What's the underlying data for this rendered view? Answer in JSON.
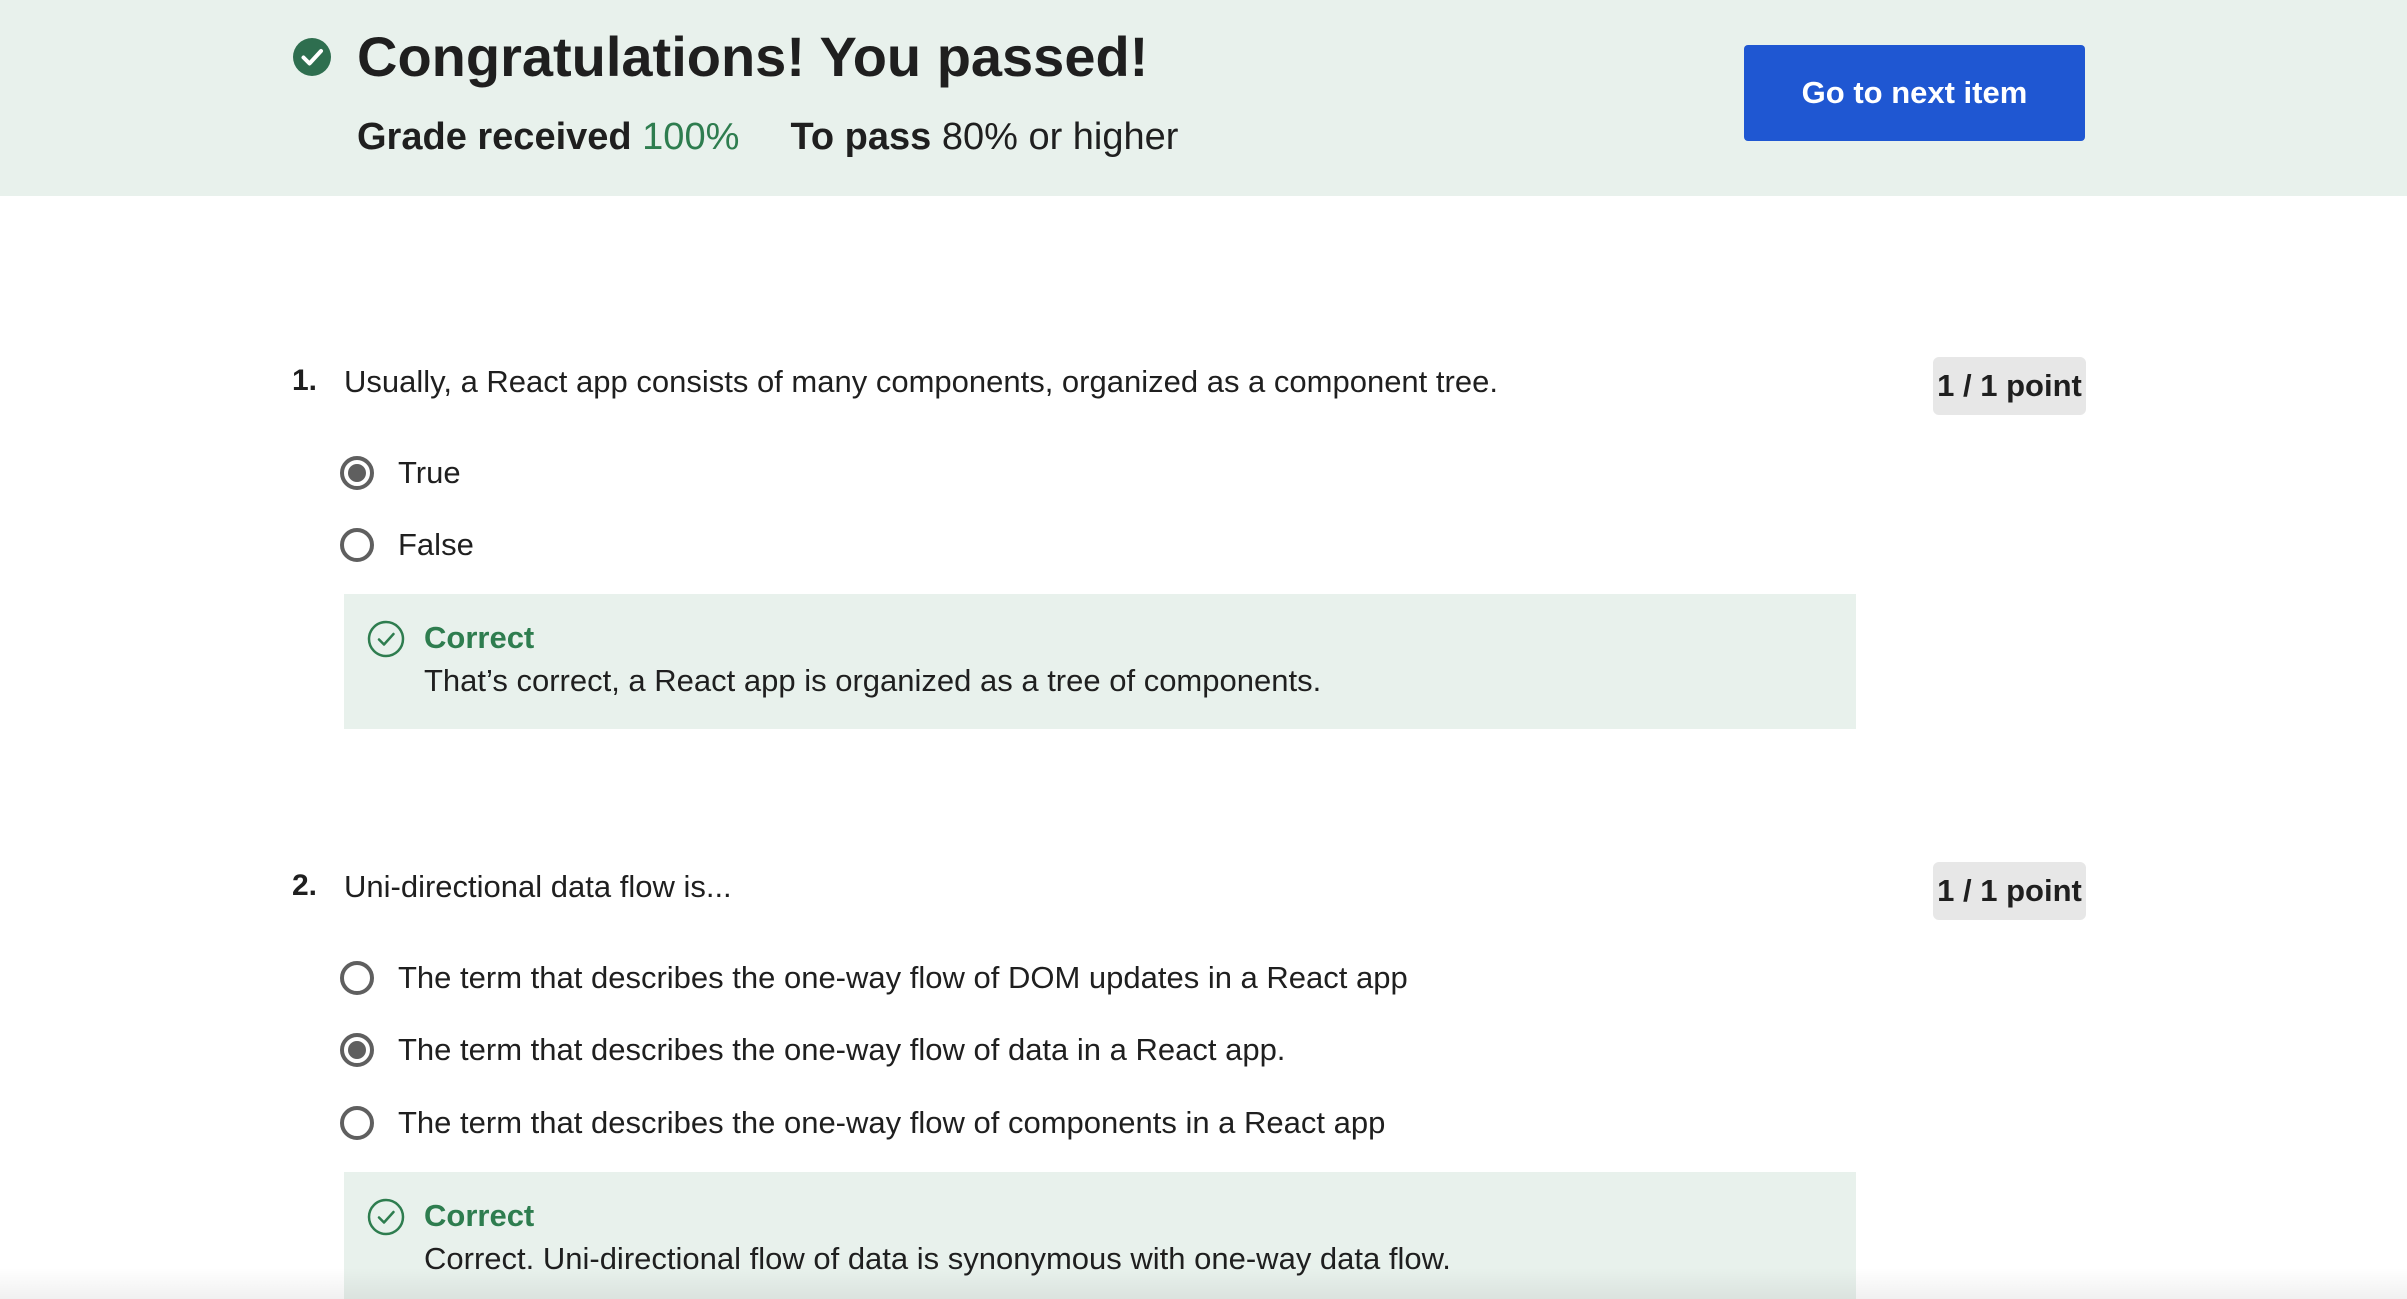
{
  "banner": {
    "title": "Congratulations! You passed!",
    "grade_label": "Grade received",
    "grade_value": "100%",
    "pass_label": "To pass",
    "pass_value": "80% or higher",
    "next_button_label": "Go to next item",
    "icon": "check-circle-filled-icon"
  },
  "questions": [
    {
      "number": "1.",
      "text": "Usually, a React app consists of many components, organized as a component tree.",
      "points": "1 / 1 point",
      "options": [
        {
          "label": "True",
          "selected": true
        },
        {
          "label": "False",
          "selected": false
        }
      ],
      "feedback": {
        "title": "Correct",
        "text": "That’s correct, a React app is organized as a tree of components.",
        "icon": "check-circle-outline-icon"
      }
    },
    {
      "number": "2.",
      "text": "Uni-directional data flow is...",
      "points": "1 / 1 point",
      "options": [
        {
          "label": "The term that describes the one-way flow of DOM updates in a React app",
          "selected": false
        },
        {
          "label": "The term that describes the one-way flow of data in a React app.",
          "selected": true
        },
        {
          "label": "The term that describes the one-way flow of components in a React app",
          "selected": false
        }
      ],
      "feedback": {
        "title": "Correct",
        "text": "Correct. Uni-directional flow of data is synonymous with one-way data flow.",
        "icon": "check-circle-outline-icon"
      }
    }
  ],
  "colors": {
    "banner_bg": "#e8f1ec",
    "success_green": "#2e7d4f",
    "primary_button": "#1f57d2",
    "badge_bg": "#e7e7e7",
    "radio_gray": "#5f5f5f"
  }
}
